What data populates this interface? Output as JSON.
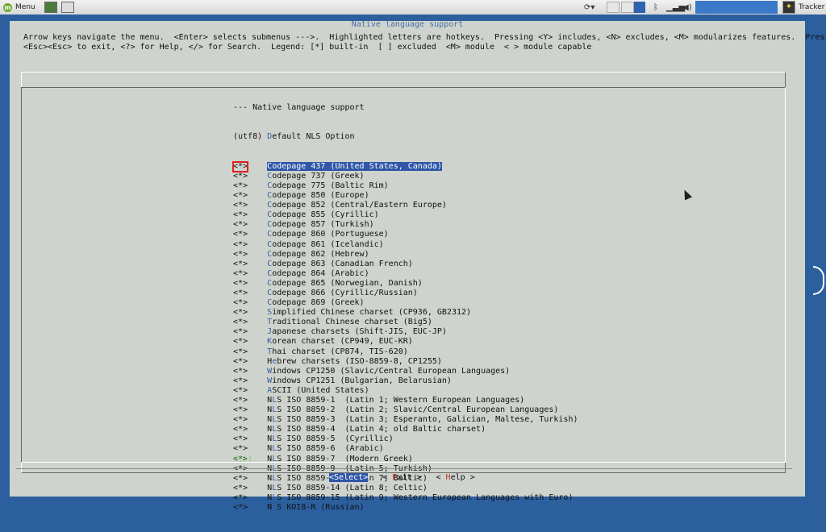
{
  "taskbar": {
    "menu_label": "Menu",
    "tracker_label": "Tracker"
  },
  "window": {
    "title": "Native language support",
    "help_line1": "Arrow keys navigate the menu.  <Enter> selects submenus --->.  Highlighted letters are hotkeys.  Pressing <Y> includes, <N> excludes, <M> modularizes features.  Press",
    "help_line2": "<Esc><Esc> to exit, <?> for Help, </> for Search.  Legend: [*] built-in  [ ] excluded  <M> module  < > module capable"
  },
  "list": {
    "header": "--- Native language support",
    "default_row": {
      "prefix": "(utf8) ",
      "hotkey": "D",
      "rest": "efault NLS Option"
    },
    "items": [
      {
        "mark": "<*>",
        "hotkey": "C",
        "rest": "odepage 437 (United States, Canada)",
        "selected": true
      },
      {
        "mark": "<*>",
        "hotkey": "C",
        "rest": "odepage 737 (Greek)"
      },
      {
        "mark": "<*>",
        "hotkey": "C",
        "rest": "odepage 775 (Baltic Rim)"
      },
      {
        "mark": "<*>",
        "hotkey": "C",
        "rest": "odepage 850 (Europe)"
      },
      {
        "mark": "<*>",
        "hotkey": "C",
        "rest": "odepage 852 (Central/Eastern Europe)"
      },
      {
        "mark": "<*>",
        "hotkey": "C",
        "rest": "odepage 855 (Cyrillic)"
      },
      {
        "mark": "<*>",
        "hotkey": "C",
        "rest": "odepage 857 (Turkish)"
      },
      {
        "mark": "<*>",
        "hotkey": "C",
        "rest": "odepage 860 (Portuguese)"
      },
      {
        "mark": "<*>",
        "hotkey": "C",
        "rest": "odepage 861 (Icelandic)"
      },
      {
        "mark": "<*>",
        "hotkey": "C",
        "rest": "odepage 862 (Hebrew)"
      },
      {
        "mark": "<*>",
        "hotkey": "C",
        "rest": "odepage 863 (Canadian French)"
      },
      {
        "mark": "<*>",
        "hotkey": "C",
        "rest": "odepage 864 (Arabic)"
      },
      {
        "mark": "<*>",
        "hotkey": "C",
        "rest": "odepage 865 (Norwegian, Danish)"
      },
      {
        "mark": "<*>",
        "hotkey": "C",
        "rest": "odepage 866 (Cyrillic/Russian)"
      },
      {
        "mark": "<*>",
        "hotkey": "C",
        "rest": "odepage 869 (Greek)"
      },
      {
        "mark": "<*>",
        "hotkey": "S",
        "rest": "implified Chinese charset (CP936, GB2312)"
      },
      {
        "mark": "<*>",
        "hotkey": "T",
        "rest": "raditional Chinese charset (Big5)"
      },
      {
        "mark": "<*>",
        "hotkey": "J",
        "rest": "apanese charsets (Shift-JIS, EUC-JP)"
      },
      {
        "mark": "<*>",
        "hotkey": "K",
        "rest": "orean charset (CP949, EUC-KR)"
      },
      {
        "mark": "<*>",
        "hotkey": "T",
        "rest": "hai charset (CP874, TIS-620)"
      },
      {
        "mark": "<*>",
        "pre": "H",
        "hotkey": "e",
        "rest": "brew charsets (ISO-8859-8, CP1255)"
      },
      {
        "mark": "<*>",
        "hotkey": "W",
        "rest": "indows CP1250 (Slavic/Central European Languages)"
      },
      {
        "mark": "<*>",
        "hotkey": "W",
        "rest": "indows CP1251 (Bulgarian, Belarusian)"
      },
      {
        "mark": "<*>",
        "hotkey": "A",
        "rest": "SCII (United States)"
      },
      {
        "mark": "<*>",
        "pre": "N",
        "hotkey": "L",
        "rest": "S ISO 8859-1  (Latin 1; Western European Languages)"
      },
      {
        "mark": "<*>",
        "pre": "N",
        "hotkey": "L",
        "rest": "S ISO 8859-2  (Latin 2; Slavic/Central European Languages)"
      },
      {
        "mark": "<*>",
        "pre": "N",
        "hotkey": "L",
        "rest": "S ISO 8859-3  (Latin 3; Esperanto, Galician, Maltese, Turkish)"
      },
      {
        "mark": "<*>",
        "pre": "N",
        "hotkey": "L",
        "rest": "S ISO 8859-4  (Latin 4; old Baltic charset)"
      },
      {
        "mark": "<*>",
        "pre": "N",
        "hotkey": "L",
        "rest": "S ISO 8859-5  (Cyrillic)"
      },
      {
        "mark": "<*>",
        "pre": "N",
        "hotkey": "L",
        "rest": "S ISO 8859-6  (Arabic)"
      },
      {
        "mark": "<*>",
        "pre": "N",
        "hotkey": "L",
        "rest": "S ISO 8859-7  (Modern Greek)"
      },
      {
        "mark": "<*>",
        "pre": "N",
        "hotkey": "L",
        "rest": "S ISO 8859-9  (Latin 5; Turkish)"
      },
      {
        "mark": "<*>",
        "pre": "N",
        "hotkey": "L",
        "rest": "S ISO 8859-13 (Latin 7; Baltic)"
      },
      {
        "mark": "<*>",
        "pre": "N",
        "hotkey": "L",
        "rest": "S ISO 8859-14 (Latin 8; Celtic)"
      },
      {
        "mark": "<*>",
        "pre": "N",
        "hotkey": "L",
        "rest": "S ISO 8859-15 (Latin 9; Western European Languages with Euro)"
      },
      {
        "mark": "<*>",
        "pre": "N",
        "hotkey": "L",
        "rest": "S KOI8-R (Russian)"
      }
    ],
    "more_indicator": "v(+)"
  },
  "buttons": {
    "select": "<Select>",
    "exit_pre": "< ",
    "exit_hotkey": "E",
    "exit_rest": "xit >",
    "help_pre": "< ",
    "help_hotkey": "H",
    "help_rest": "elp >"
  },
  "colors": {
    "selection": "#2f56a8",
    "hotkey": "#3a5fa0",
    "dialog_bg": "#cfd3cd",
    "desktop_bg": "#2c5f9e"
  }
}
